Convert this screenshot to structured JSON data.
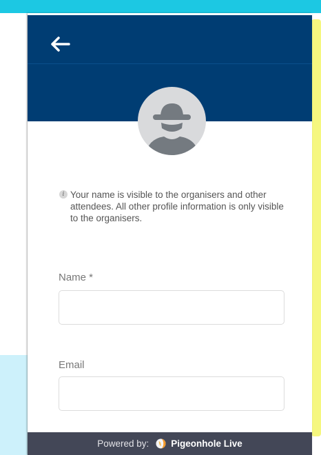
{
  "colors": {
    "top_accent": "#1cc8e3",
    "header": "#003d73",
    "footer": "#434757",
    "highlight": "#f5f77f"
  },
  "header": {
    "back_icon": "arrow-left-icon"
  },
  "profile": {
    "avatar_icon": "incognito-user-icon"
  },
  "info": {
    "icon": "info-icon",
    "icon_glyph": "i",
    "text": "Your name is visible to the organisers and other attendees. All other profile information is only visible to the organisers."
  },
  "form": {
    "name_label": "Name *",
    "name_value": "",
    "email_label": "Email",
    "email_value": ""
  },
  "footer": {
    "powered_label": "Powered by:",
    "brand_name": "Pigeonhole Live",
    "brand_icon": "pigeonhole-logo-icon"
  }
}
